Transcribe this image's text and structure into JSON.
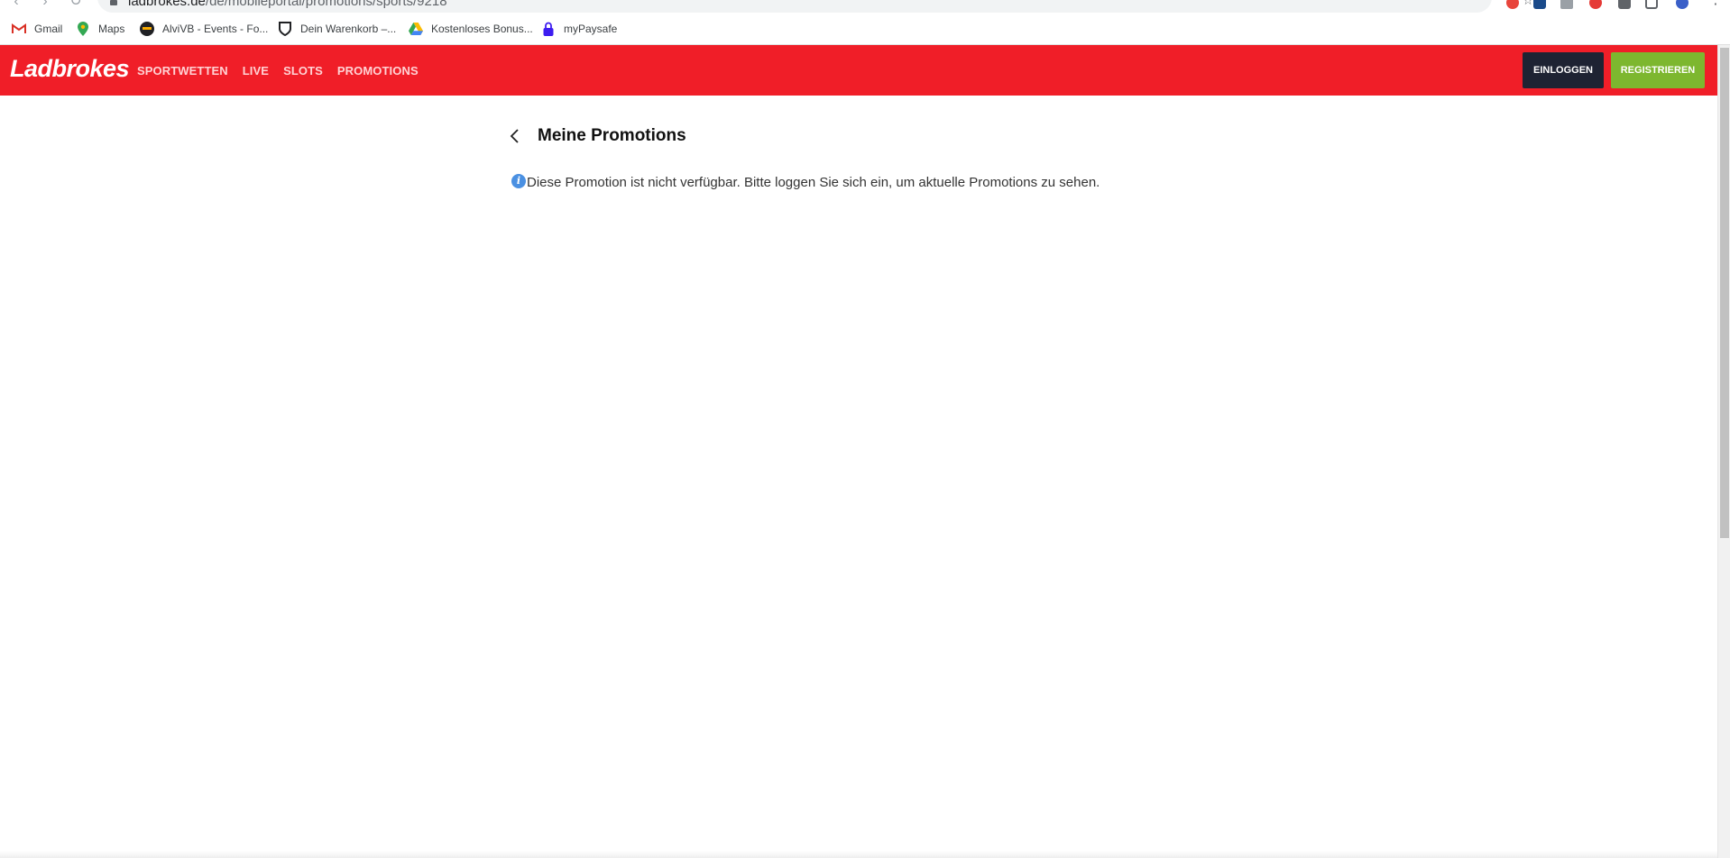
{
  "browser": {
    "url_host": "ladbrokes.de",
    "url_path": "/de/mobileportal/promotions/sports/9218",
    "bookmarks": [
      {
        "label": "Gmail",
        "icon": "gmail-icon"
      },
      {
        "label": "Maps",
        "icon": "maps-icon"
      },
      {
        "label": "AlviVB - Events - Fo...",
        "icon": "alvivb-icon"
      },
      {
        "label": "Dein Warenkorb –...",
        "icon": "shield-icon"
      },
      {
        "label": "Kostenloses Bonus...",
        "icon": "google-drive-icon"
      },
      {
        "label": "myPaysafe",
        "icon": "padlock-icon"
      }
    ]
  },
  "header": {
    "logo": "Ladbrokes",
    "nav": [
      "SPORTWETTEN",
      "LIVE",
      "SLOTS",
      "PROMOTIONS"
    ],
    "login_label": "EINLOGGEN",
    "register_label": "REGISTRIEREN"
  },
  "main": {
    "title": "Meine Promotions",
    "notice": "Diese Promotion ist nicht verfügbar. Bitte loggen Sie sich ein, um aktuelle Promotions zu sehen."
  },
  "colors": {
    "brand_red": "#f01e28",
    "login_bg": "#1e2333",
    "register_bg": "#7db72f",
    "info_blue": "#4a90e2"
  }
}
